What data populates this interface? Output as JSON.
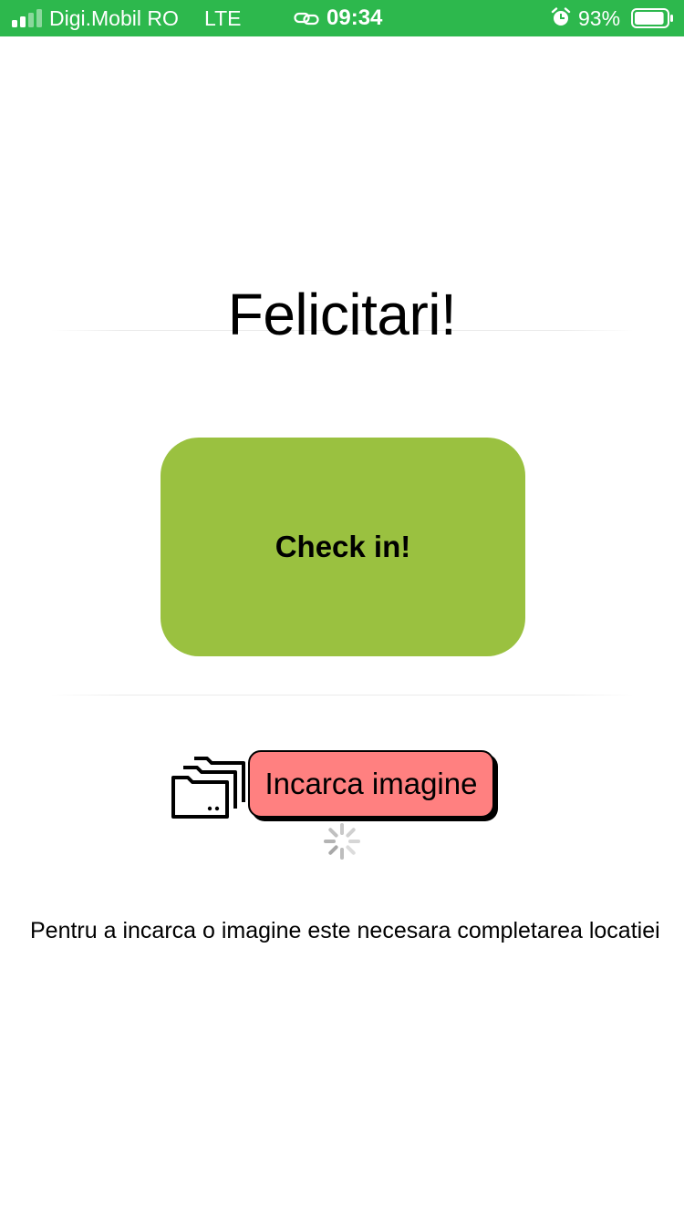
{
  "status_bar": {
    "carrier": "Digi.Mobil RO",
    "network": "LTE",
    "time": "09:34",
    "battery": "93%",
    "battery_level": 0.93,
    "signal_bars_active": 2,
    "signal_bars_total": 4,
    "background_color": "#2db84d",
    "icons": [
      "signal-icon",
      "link-icon",
      "alarm-icon",
      "battery-icon"
    ]
  },
  "page": {
    "title": "Felicitari!",
    "checkin_label": "Check in!",
    "checkin_color": "#9ac140",
    "upload_label": "Incarca imagine",
    "upload_color": "#ff8080",
    "upload_icon": "folders-icon",
    "loading_icon": "spinner-icon",
    "notice": "Pentru a incarca o imagine este necesara completarea locatiei"
  }
}
